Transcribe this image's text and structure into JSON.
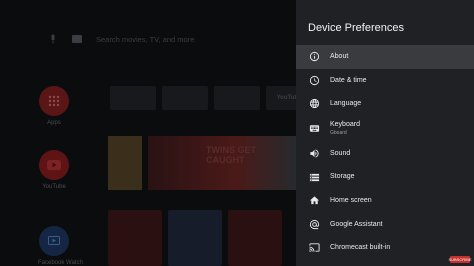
{
  "home": {
    "search_hint": "Search movies, TV, and more",
    "apps": [
      {
        "label": "Apps",
        "color": "#7a1f1f"
      },
      {
        "label": "YouTube",
        "color": "#8a1c1c"
      },
      {
        "label": "Facebook Watch",
        "color": "#1f3a6a"
      }
    ],
    "channels": [
      "",
      "",
      "",
      "YouTube"
    ],
    "promo_line1": "TWINS GET",
    "promo_line2": "CAUGHT"
  },
  "panel": {
    "title": "Device Preferences",
    "items": [
      {
        "label": "About",
        "sub": "",
        "icon": "info-icon",
        "selected": true
      },
      {
        "label": "Date & time",
        "sub": "",
        "icon": "clock-icon",
        "selected": false
      },
      {
        "label": "Language",
        "sub": "",
        "icon": "globe-icon",
        "selected": false
      },
      {
        "label": "Keyboard",
        "sub": "Gboard",
        "icon": "keyboard-icon",
        "selected": false
      },
      {
        "label": "Sound",
        "sub": "",
        "icon": "speaker-icon",
        "selected": false
      },
      {
        "label": "Storage",
        "sub": "",
        "icon": "storage-icon",
        "selected": false
      },
      {
        "label": "Home screen",
        "sub": "",
        "icon": "home-icon",
        "selected": false
      },
      {
        "label": "Google Assistant",
        "sub": "",
        "icon": "assistant-icon",
        "selected": false
      },
      {
        "label": "Chromecast built-in",
        "sub": "",
        "icon": "cast-icon",
        "selected": false
      }
    ]
  },
  "colors": {
    "panel_bg": "#202125",
    "selected_bg": "#3a3b3f",
    "text": "#e8eaed"
  },
  "overlay": {
    "subscribe": "SUBSCRIBE"
  }
}
